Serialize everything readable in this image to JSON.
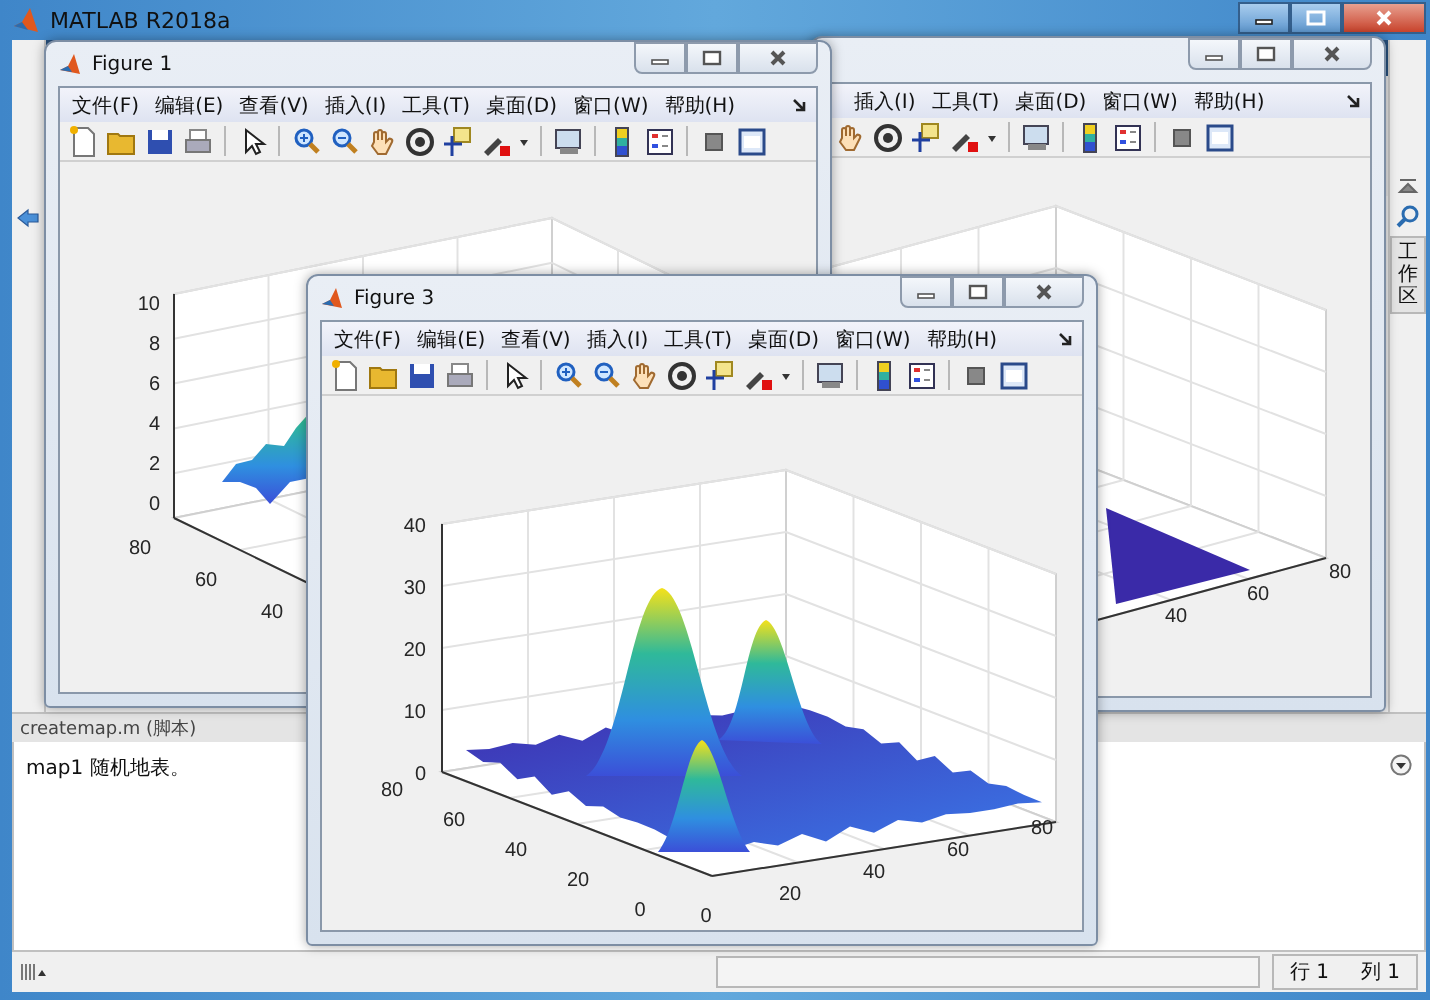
{
  "main_window": {
    "title": "MATLAB R2018a"
  },
  "figures": [
    {
      "title": "Figure 1",
      "covered": false,
      "menu": [
        "文件(F)",
        "编辑(E)",
        "查看(V)",
        "插入(I)",
        "工具(T)",
        "桌面(D)",
        "窗口(W)",
        "帮助(H)"
      ],
      "plot": {
        "kind": "ridge",
        "z_ticks": [
          "10",
          "8",
          "6",
          "4",
          "2",
          "0"
        ],
        "y_ticks": [
          "80",
          "60",
          "40"
        ]
      }
    },
    {
      "covered": true,
      "menu": [
        "插入(I)",
        "工具(T)",
        "桌面(D)",
        "窗口(W)",
        "帮助(H)"
      ],
      "plot": {
        "kind": "flat",
        "x_ticks": [
          "40",
          "60",
          "80"
        ]
      }
    },
    {
      "title": "Figure 3",
      "covered": false,
      "menu": [
        "文件(F)",
        "编辑(E)",
        "查看(V)",
        "插入(I)",
        "工具(T)",
        "桌面(D)",
        "窗口(W)",
        "帮助(H)"
      ],
      "plot": {
        "kind": "peaks",
        "z_ticks": [
          "40",
          "30",
          "20",
          "10",
          "0"
        ],
        "y_ticks": [
          "80",
          "60",
          "40",
          "20",
          "0"
        ],
        "x_ticks": [
          "0",
          "20",
          "40",
          "60",
          "80"
        ]
      }
    }
  ],
  "side_panel": {
    "label": "工作区"
  },
  "editor": {
    "tab": "createmap.m (脚本)",
    "text": "map1 随机地表。"
  },
  "status_bar": {
    "line": "行 1",
    "column": "列 1"
  }
}
